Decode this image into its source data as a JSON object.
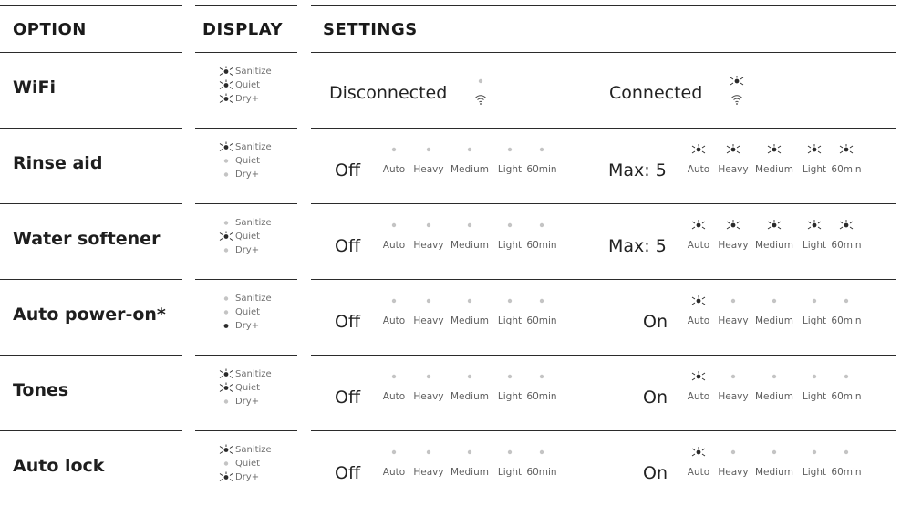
{
  "header": {
    "option": "OPTION",
    "display": "DISPLAY",
    "settings": "SETTINGS"
  },
  "cycle_labels": [
    "Auto",
    "Heavy",
    "Medium",
    "Light",
    "60min"
  ],
  "display_labels": [
    "Sanitize",
    "Quiet",
    "Dry+"
  ],
  "indicator_states": {
    "lit": "lit with rays",
    "dot": "solid dark dot",
    "off": "faint gray dot"
  },
  "rows": [
    {
      "name": "WiFi",
      "display": [
        "lit",
        "lit",
        "lit"
      ],
      "setting_a": {
        "label": "Disconnected",
        "wifi_light": "off"
      },
      "setting_b": {
        "label": "Connected",
        "wifi_light": "lit"
      }
    },
    {
      "name": "Rinse aid",
      "display": [
        "lit",
        "off",
        "off"
      ],
      "setting_a": {
        "label": "Off",
        "cycles": [
          "off",
          "off",
          "off",
          "off",
          "off"
        ]
      },
      "setting_b": {
        "label": "Max: 5",
        "cycles": [
          "lit",
          "lit",
          "lit",
          "lit",
          "lit"
        ]
      }
    },
    {
      "name": "Water softener",
      "display": [
        "off",
        "lit",
        "off"
      ],
      "setting_a": {
        "label": "Off",
        "cycles": [
          "off",
          "off",
          "off",
          "off",
          "off"
        ]
      },
      "setting_b": {
        "label": "Max: 5",
        "cycles": [
          "lit",
          "lit",
          "lit",
          "lit",
          "lit"
        ]
      }
    },
    {
      "name": "Auto power-on*",
      "display": [
        "off",
        "off",
        "dot"
      ],
      "setting_a": {
        "label": "Off",
        "cycles": [
          "off",
          "off",
          "off",
          "off",
          "off"
        ]
      },
      "setting_b": {
        "label": "On",
        "cycles": [
          "lit",
          "off",
          "off",
          "off",
          "off"
        ]
      }
    },
    {
      "name": "Tones",
      "display": [
        "lit",
        "lit",
        "off"
      ],
      "setting_a": {
        "label": "Off",
        "cycles": [
          "off",
          "off",
          "off",
          "off",
          "off"
        ]
      },
      "setting_b": {
        "label": "On",
        "cycles": [
          "lit",
          "off",
          "off",
          "off",
          "off"
        ]
      }
    },
    {
      "name": "Auto lock",
      "display": [
        "lit",
        "off",
        "lit"
      ],
      "setting_a": {
        "label": "Off",
        "cycles": [
          "off",
          "off",
          "off",
          "off",
          "off"
        ]
      },
      "setting_b": {
        "label": "On",
        "cycles": [
          "lit",
          "off",
          "off",
          "off",
          "off"
        ]
      }
    }
  ],
  "colors": {
    "text": "#1e1e1e",
    "rule": "#2b2b2b",
    "indicator_dark": "#2a2a2a",
    "indicator_off": "#c4c4c4",
    "label_gray": "#6a6a6a"
  }
}
